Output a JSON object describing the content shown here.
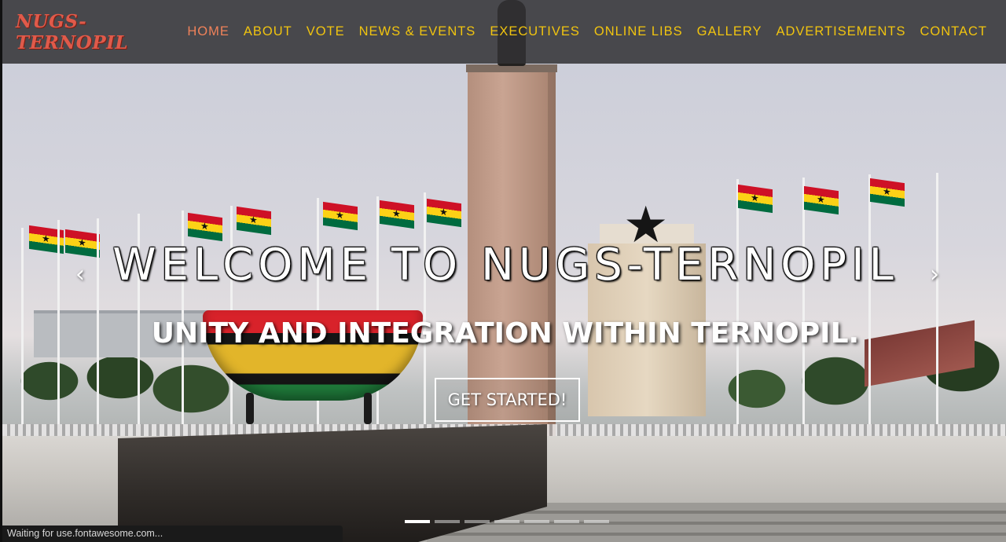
{
  "brand": {
    "name": "NUGS-TERNOPIL"
  },
  "nav": {
    "items": [
      {
        "label": "HOME"
      },
      {
        "label": "ABOUT"
      },
      {
        "label": "VOTE"
      },
      {
        "label": "NEWS & EVENTS"
      },
      {
        "label": "EXECUTIVES"
      },
      {
        "label": "ONLINE LIBS"
      },
      {
        "label": "GALLERY"
      },
      {
        "label": "ADVERTISEMENTS"
      },
      {
        "label": "CONTACT"
      }
    ],
    "active_index": 0
  },
  "hero": {
    "headline": "WELCOME TO NUGS-TERNOPIL",
    "subheadline": "UNITY AND INTEGRATION WITHIN TERNOPIL.",
    "cta_label": "GET STARTED!",
    "prev_icon": "‹",
    "next_icon": "›"
  },
  "carousel": {
    "slide_count": 7,
    "active_slide": 1
  },
  "status_bar": {
    "text": "Waiting for use.fontawesome.com..."
  },
  "colors": {
    "nav_bg": "#323234",
    "nav_link": "#f1c40f",
    "nav_active": "#f0825a",
    "brand": "#e05a4a"
  }
}
